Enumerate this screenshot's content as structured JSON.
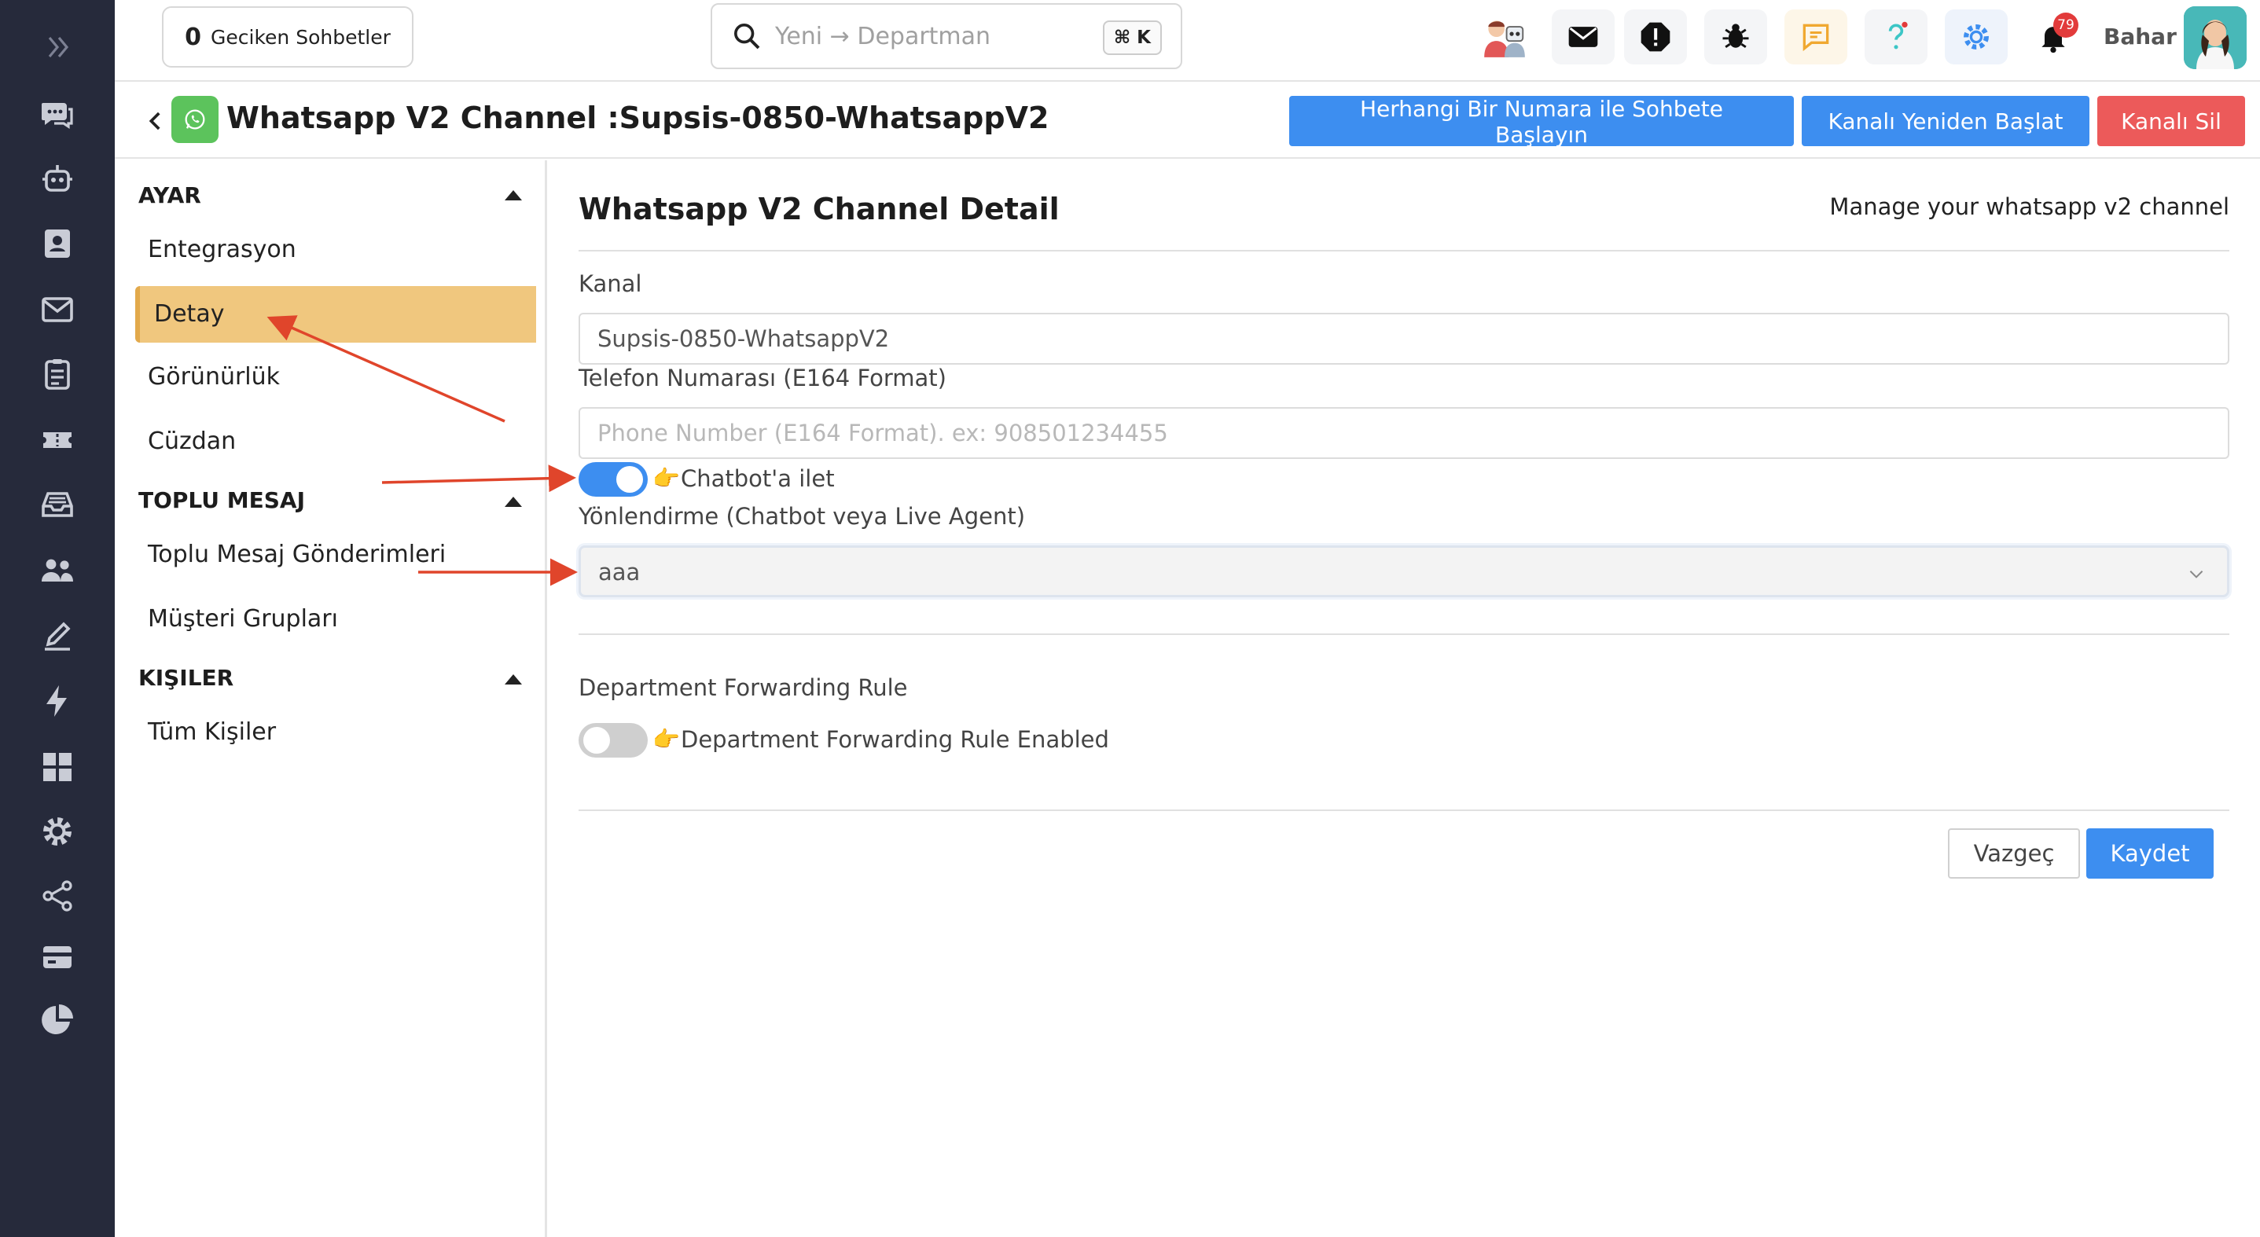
{
  "topbar": {
    "late_chats_count": "0",
    "late_chats_label": "Geciken Sohbetler",
    "search_placeholder": "Yeni → Departman",
    "search_shortcut": "⌘ K",
    "notification_count": "79",
    "user_name": "Bahar"
  },
  "header": {
    "title": "Whatsapp V2 Channel :Supsis-0850-WhatsappV2",
    "start_chat_button": "Herhangi Bir Numara ile Sohbete Başlayın",
    "restart_button": "Kanalı Yeniden Başlat",
    "delete_button": "Kanalı Sil"
  },
  "subnav": {
    "sections": [
      {
        "title": "AYAR",
        "items": [
          "Entegrasyon",
          "Detay",
          "Görünürlük",
          "Cüzdan"
        ]
      },
      {
        "title": "TOPLU MESAJ",
        "items": [
          "Toplu Mesaj Gönderimleri",
          "Müşteri Grupları"
        ]
      },
      {
        "title": "KIŞILER",
        "items": [
          "Tüm Kişiler"
        ]
      }
    ],
    "active_item": "Detay"
  },
  "main": {
    "title": "Whatsapp V2 Channel Detail",
    "subtitle": "Manage your whatsapp v2 channel",
    "channel_label": "Kanal",
    "channel_value": "Supsis-0850-WhatsappV2",
    "phone_label": "Telefon Numarası (E164 Format)",
    "phone_placeholder": "Phone Number (E164 Format). ex: 908501234455",
    "chatbot_toggle_label": "Chatbot'a ilet",
    "chatbot_toggle_on": true,
    "routing_label": "Yönlendirme (Chatbot veya Live Agent)",
    "routing_value": "aaa",
    "dept_rule_title": "Department Forwarding Rule",
    "dept_rule_toggle_label": "Department Forwarding Rule Enabled",
    "dept_rule_toggle_on": false,
    "hand_glyph": "👉",
    "cancel_button": "Vazgeç",
    "save_button": "Kaydet"
  },
  "colors": {
    "rail": "#262a3b",
    "primary": "#3d8ef0",
    "danger": "#ec5a5a",
    "active_nav": "#f0c77e",
    "annotation_arrow": "#e0452b"
  }
}
